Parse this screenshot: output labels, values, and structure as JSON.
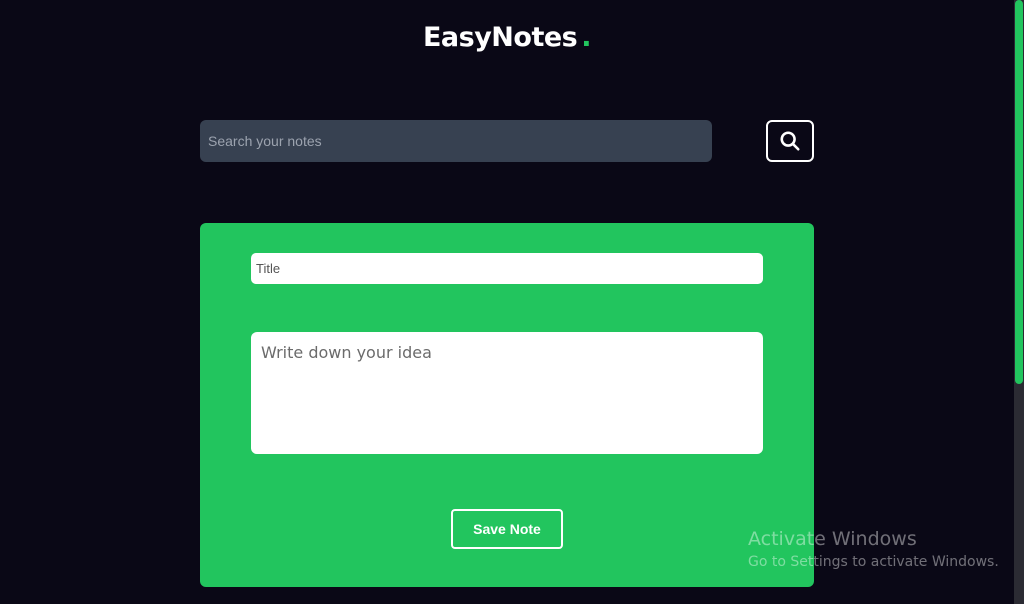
{
  "header": {
    "logo_text": "EasyNotes",
    "logo_dot": "."
  },
  "search": {
    "placeholder": "Search your notes",
    "value": "",
    "button_icon": "search-icon"
  },
  "note_form": {
    "title_placeholder": "Title",
    "title_value": "",
    "body_placeholder": "Write down your idea",
    "body_value": "",
    "save_label": "Save Note"
  },
  "watermark": {
    "title": "Activate Windows",
    "subtitle": "Go to Settings to activate Windows."
  },
  "colors": {
    "background": "#0a0816",
    "accent": "#22c55e",
    "search_field": "#374151"
  }
}
